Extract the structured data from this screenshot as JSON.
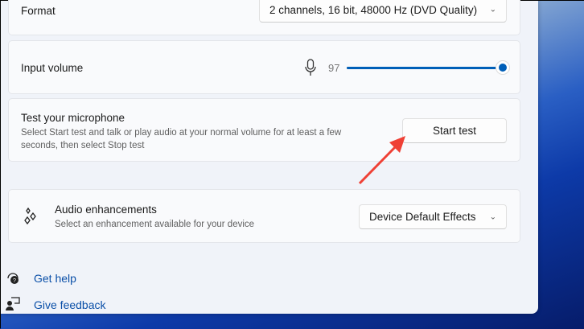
{
  "format": {
    "label": "Format",
    "value": "2 channels, 16 bit, 48000 Hz (DVD Quality)"
  },
  "input_volume": {
    "label": "Input volume",
    "value": "97",
    "percent": 97
  },
  "test_mic": {
    "title": "Test your microphone",
    "description": "Select Start test and talk or play audio at your normal volume for at least a few seconds, then select Stop test",
    "button": "Start test"
  },
  "audio_enhancements": {
    "title": "Audio enhancements",
    "description": "Select an enhancement available for your device",
    "value": "Device Default Effects"
  },
  "links": {
    "help": "Get help",
    "feedback": "Give feedback"
  },
  "colors": {
    "accent": "#005fb8",
    "arrow": "#ef4035"
  }
}
